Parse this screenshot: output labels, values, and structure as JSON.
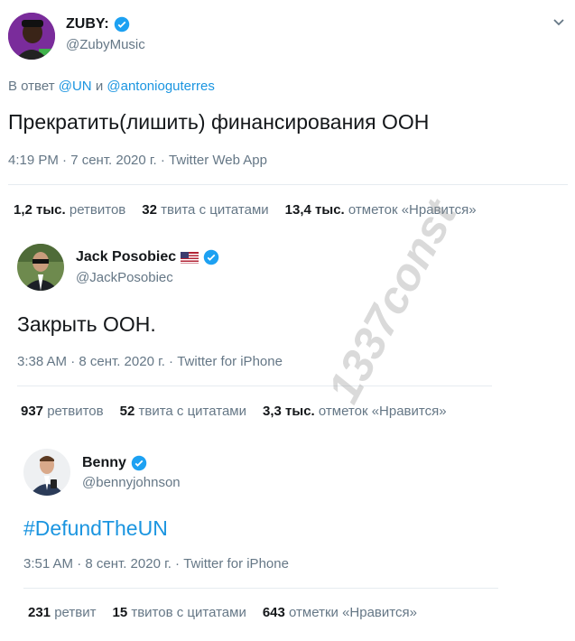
{
  "watermark": "1337const",
  "tweets": [
    {
      "name": "ZUBY:",
      "handle": "@ZubyMusic",
      "reply_prefix": "В ответ",
      "reply_to_1": "@UN",
      "reply_and": "и",
      "reply_to_2": "@antonioguterres",
      "text": "Прекратить(лишить) финансирования ООН",
      "meta": "4:19 PM · 7 сент. 2020 г. · Twitter Web App",
      "stats": {
        "retweets_count": "1,2 тыс.",
        "retweets_label": "ретвитов",
        "quotes_count": "32",
        "quotes_label": "твита с цитатами",
        "likes_count": "13,4 тыс.",
        "likes_label": "отметок «Нравится»"
      }
    },
    {
      "name": "Jack Posobiec",
      "handle": "@JackPosobiec",
      "text": "Закрыть ООН.",
      "meta": "3:38 AM · 8 сент. 2020 г. · Twitter for iPhone",
      "stats": {
        "retweets_count": "937",
        "retweets_label": "ретвитов",
        "quotes_count": "52",
        "quotes_label": "твита с цитатами",
        "likes_count": "3,3 тыс.",
        "likes_label": "отметок «Нравится»"
      }
    },
    {
      "name": "Benny",
      "handle": "@bennyjohnson",
      "text": "#DefundTheUN",
      "meta": "3:51 AM · 8 сент. 2020 г. · Twitter for iPhone",
      "stats": {
        "retweets_count": "231",
        "retweets_label": "ретвит",
        "quotes_count": "15",
        "quotes_label": "твитов с цитатами",
        "likes_count": "643",
        "likes_label": "отметки «Нравится»"
      }
    }
  ],
  "colors": {
    "verified": "#1da1f2",
    "link": "#1b95e0",
    "muted": "#657786"
  },
  "icons": [
    "verified-badge-icon",
    "chevron-down-icon",
    "us-flag-icon"
  ]
}
